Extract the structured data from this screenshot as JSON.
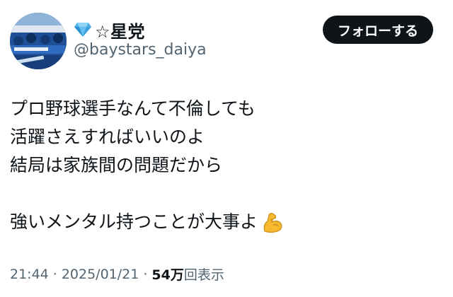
{
  "user": {
    "display_name": "☆星党",
    "handle": "@baystars_daiya",
    "badge_icon": "gem-icon"
  },
  "actions": {
    "follow_label": "フォローする"
  },
  "tweet": {
    "lines": [
      "プロ野球選手なんて不倫しても",
      "活躍さえすればいいのよ",
      "結局は家族間の問題だから",
      "",
      "強いメンタル持つことが大事よ"
    ],
    "trailing_emoji": "flexed-biceps-icon"
  },
  "meta": {
    "time": "21:44",
    "date": "2025/01/21",
    "separator": "·",
    "views_count": "54万",
    "views_label": "回表示"
  },
  "colors": {
    "text": "#0f1419",
    "secondary": "#536471",
    "button_bg": "#0f1419",
    "gem": "#4fb0e8"
  }
}
